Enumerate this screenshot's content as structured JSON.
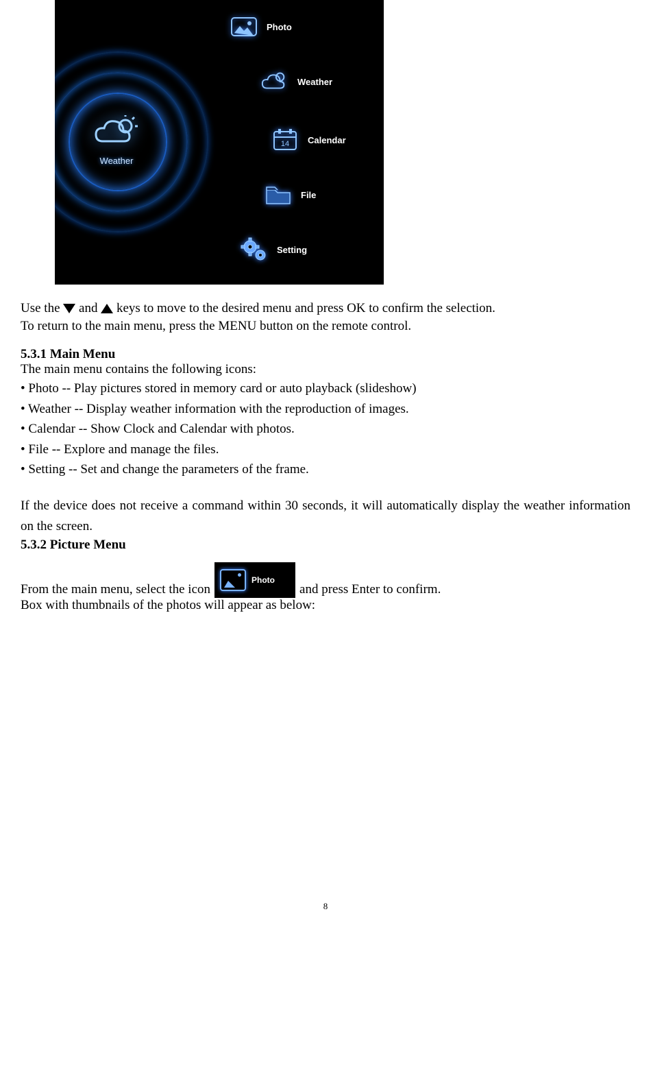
{
  "screenshot": {
    "selected_label": "Weather",
    "items": [
      {
        "label": "Photo"
      },
      {
        "label": "Weather"
      },
      {
        "label": "Calendar"
      },
      {
        "label": "File"
      },
      {
        "label": "Setting"
      }
    ]
  },
  "instr": {
    "line1a": "Use the ",
    "line1b": " and ",
    "line1c": " keys to move to the desired menu and press OK to confirm the selection.",
    "line2": "To return to the main menu, press the MENU button on the remote control."
  },
  "sec531": {
    "heading": "5.3.1 Main Menu",
    "intro": "The main menu contains the following icons:",
    "bullets": [
      "• Photo -- Play pictures stored in memory card or auto playback (slideshow)",
      "• Weather -- Display weather information with the reproduction of images.",
      "• Calendar -- Show Clock and Calendar with photos.",
      "• File -- Explore and manage the files.",
      "• Setting -- Set and change the parameters of the frame."
    ],
    "timeout": "If the device does not receive a command within 30 seconds, it will automatically display the weather information on the screen."
  },
  "sec532": {
    "heading": "5.3.2 Picture Menu",
    "row_a": "From the main menu, select the icon ",
    "chip_label": "Photo",
    "row_b": " and press Enter to confirm.",
    "line2": "Box with thumbnails of the photos will appear as below:"
  },
  "page_number": "8"
}
